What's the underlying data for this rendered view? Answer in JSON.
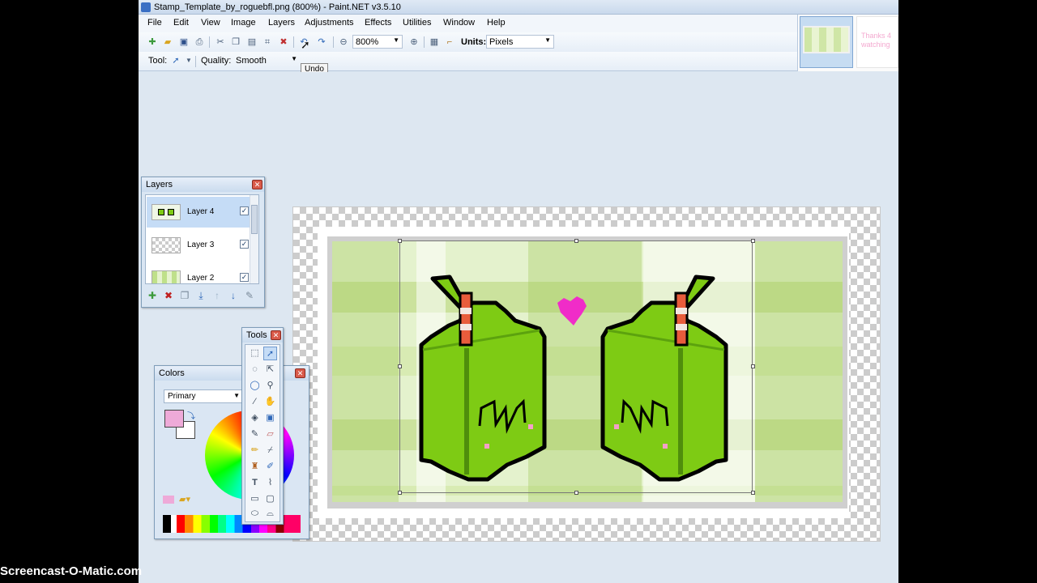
{
  "window": {
    "title": "Stamp_Template_by_roguebfl.png (800%) - Paint.NET v3.5.10"
  },
  "menu": [
    "File",
    "Edit",
    "View",
    "Image",
    "Layers",
    "Adjustments",
    "Effects",
    "Utilities",
    "Window",
    "Help"
  ],
  "toolbar": {
    "zoom_value": "800%",
    "units_label": "Units:",
    "units_value": "Pixels",
    "tool_label": "Tool:",
    "quality_label": "Quality:",
    "quality_value": "Smooth",
    "undo_tooltip": "Undo"
  },
  "image_strip": {
    "thumb2_text": "Thanks 4 watching"
  },
  "layers_panel": {
    "title": "Layers",
    "layers": [
      {
        "name": "Layer 4",
        "visible": true,
        "selected": true
      },
      {
        "name": "Layer 3",
        "visible": true,
        "selected": false
      },
      {
        "name": "Layer 2",
        "visible": true,
        "selected": false
      }
    ]
  },
  "tools_panel": {
    "title": "Tools"
  },
  "colors_panel": {
    "title": "Colors",
    "mode_value": "Primary",
    "primary_color": "#eeaad8",
    "secondary_color": "#ffffff"
  },
  "watermark": "Screencast-O-Matic.com",
  "colors": {
    "accent": "#3a6fc4",
    "juice_green": "#7ecb14",
    "heart": "#f02cc8",
    "straw_red": "#e85c3c"
  }
}
